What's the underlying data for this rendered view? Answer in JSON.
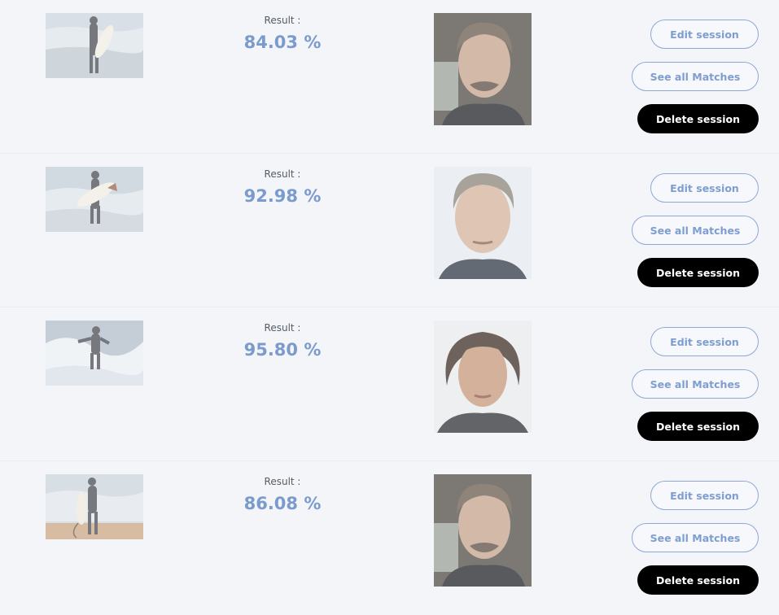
{
  "sessions": [
    {
      "result_label": "Result :",
      "result_value": "84.03 %",
      "buttons": {
        "edit": "Edit session",
        "matches": "See all Matches",
        "delete": "Delete session"
      }
    },
    {
      "result_label": "Result :",
      "result_value": "92.98 %",
      "buttons": {
        "edit": "Edit session",
        "matches": "See all Matches",
        "delete": "Delete session"
      }
    },
    {
      "result_label": "Result :",
      "result_value": "95.80 %",
      "buttons": {
        "edit": "Edit session",
        "matches": "See all Matches",
        "delete": "Delete session"
      }
    },
    {
      "result_label": "Result :",
      "result_value": "86.08 %",
      "buttons": {
        "edit": "Edit session",
        "matches": "See all Matches",
        "delete": "Delete session"
      }
    }
  ],
  "colors": {
    "background": "#f3f5f9",
    "result_value": "#7b9bcc",
    "outline_button": "#8ea8d6",
    "delete_button": "#000000"
  }
}
